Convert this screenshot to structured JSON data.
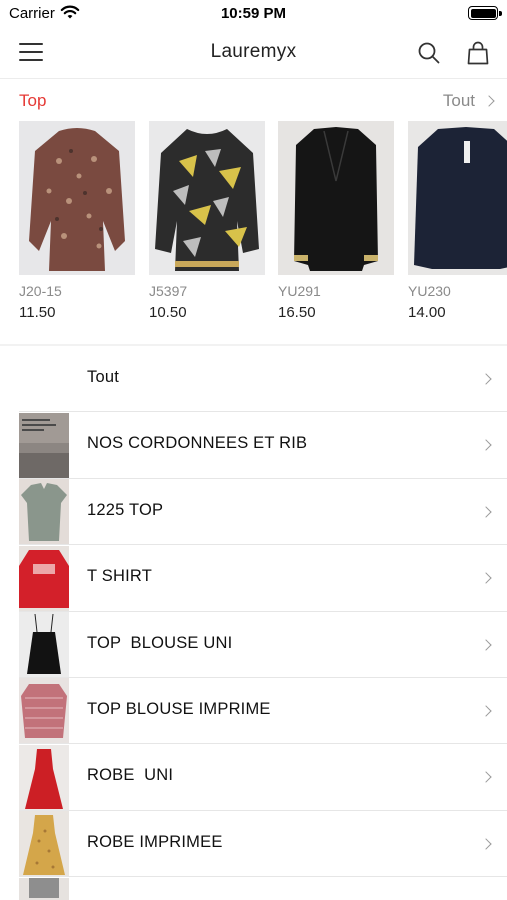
{
  "status_bar": {
    "carrier": "Carrier",
    "time": "10:59 PM"
  },
  "nav": {
    "title": "Lauremyx",
    "menu_icon": "hamburger-menu-icon",
    "search_icon": "search-icon",
    "bag_icon": "shopping-bag-icon"
  },
  "section": {
    "title": "Top",
    "see_all": "Tout",
    "accent_color": "#e53935"
  },
  "products": [
    {
      "code": "J20-15",
      "price": "11.50"
    },
    {
      "code": "J5397",
      "price": "10.50"
    },
    {
      "code": "YU291",
      "price": "16.50"
    },
    {
      "code": "YU230",
      "price": "14.00"
    }
  ],
  "categories": [
    {
      "label": "Tout"
    },
    {
      "label": "NOS CORDONNEES ET RIB"
    },
    {
      "label": "1225 TOP"
    },
    {
      "label": "T SHIRT"
    },
    {
      "label": "TOP  BLOUSE UNI"
    },
    {
      "label": "TOP BLOUSE IMPRIME"
    },
    {
      "label": "ROBE  UNI"
    },
    {
      "label": "ROBE IMPRIMEE"
    },
    {
      "label": ""
    }
  ]
}
